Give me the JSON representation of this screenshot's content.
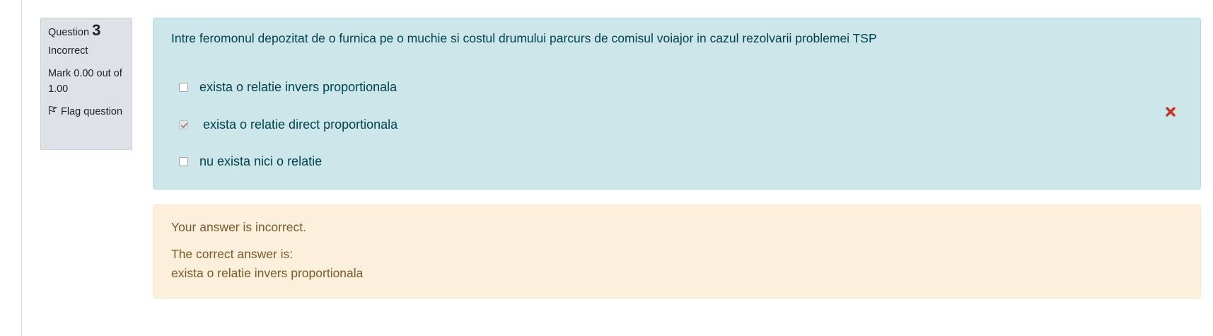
{
  "question_info": {
    "label": "Question",
    "number": "3",
    "state": "Incorrect",
    "grade": "Mark 0.00 out of 1.00",
    "flag_label": "Flag question"
  },
  "question": {
    "text": "Intre feromonul depozitat de o furnica pe o muchie si costul drumului parcurs de comisul voiajor in cazul rezolvarii problemei TSP",
    "answers": [
      {
        "label": "exista o relatie invers proportionala",
        "checked": false
      },
      {
        "label": "exista o relatie direct proportionala",
        "checked": true,
        "mark": "incorrect-icon"
      },
      {
        "label": "nu exista nici o relatie",
        "checked": false
      }
    ]
  },
  "feedback": {
    "result": "Your answer is incorrect.",
    "correct_intro": "The correct answer is:",
    "correct_answer": "exista o relatie invers proportionala"
  },
  "colors": {
    "formulation_bg": "#cce6ea",
    "formulation_text": "#00434e",
    "outcome_bg": "#fcefdc",
    "outcome_text": "#7d5a29",
    "info_bg": "#dee2e6",
    "incorrect_icon": "#ca3120"
  }
}
